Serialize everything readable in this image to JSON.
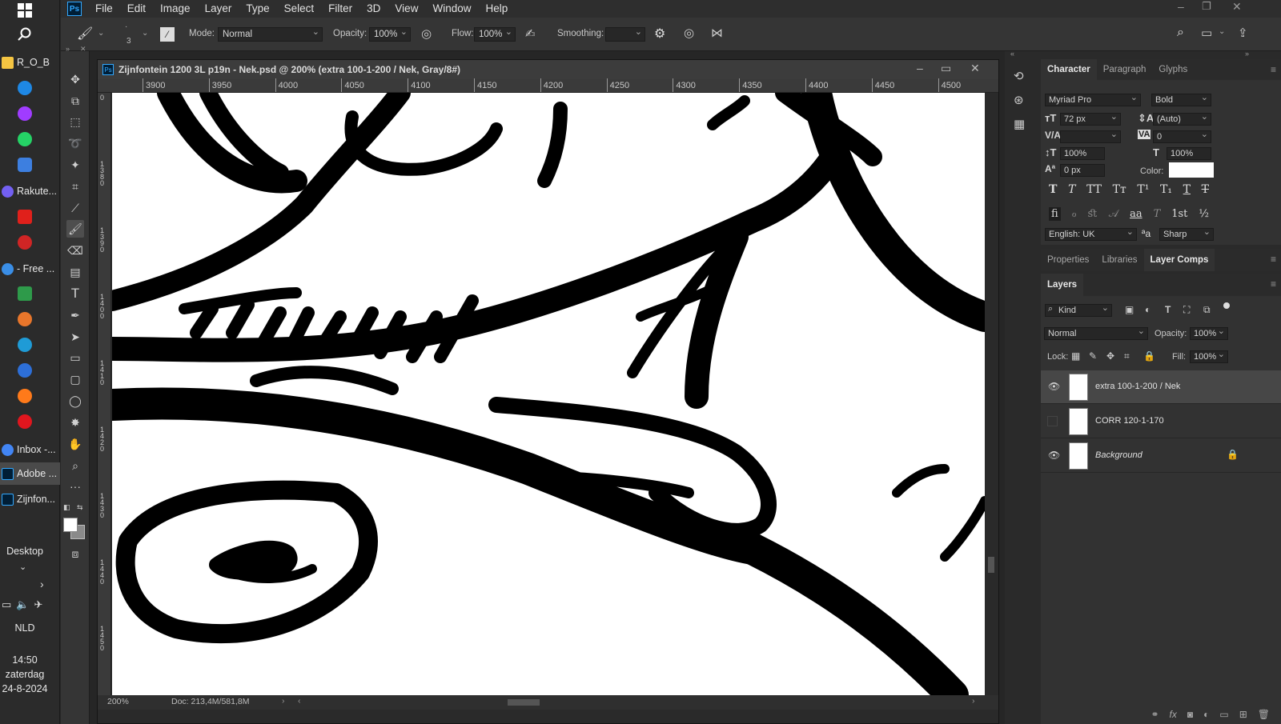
{
  "taskbar": {
    "items": [
      {
        "label": "R_O_B",
        "color": "#f5c542"
      },
      {
        "label": "Rakute...",
        "color": "#7360f2"
      },
      {
        "label": "- Free ...",
        "color": "#3a8ee6"
      },
      {
        "label": "Inbox -...",
        "color": "#4285f4"
      },
      {
        "label": "Adobe ...",
        "color": "#31a8ff"
      },
      {
        "label": "Zijnfon...",
        "color": "#31a8ff"
      }
    ],
    "desktop": "Desktop",
    "lang": "NLD",
    "time": "14:50",
    "day": "zaterdag",
    "date": "24-8-2024"
  },
  "menu": [
    "File",
    "Edit",
    "Image",
    "Layer",
    "Type",
    "Select",
    "Filter",
    "3D",
    "View",
    "Window",
    "Help"
  ],
  "logo": "Ps",
  "options": {
    "brush_size": "3",
    "mode_label": "Mode:",
    "mode_value": "Normal",
    "opacity_label": "Opacity:",
    "opacity_value": "100%",
    "flow_label": "Flow:",
    "flow_value": "100%",
    "smoothing_label": "Smoothing:",
    "smoothing_value": ""
  },
  "document": {
    "title": "Zijnfontein 1200 3L p19n - Nek.psd @ 200% (extra 100-1-200 / Nek, Gray/8#)",
    "ruler": [
      "3900",
      "3950",
      "4000",
      "4050",
      "4100",
      "4150",
      "4200",
      "4250",
      "4300",
      "4350",
      "4400",
      "4450",
      "4500"
    ],
    "vruler": [
      "0",
      "1380",
      "1390",
      "1400",
      "1410",
      "1420",
      "1430",
      "1440",
      "1450"
    ],
    "zoom": "200%",
    "doc_info": "Doc: 213,4M/581,8M"
  },
  "character": {
    "tabs": [
      "Character",
      "Paragraph",
      "Glyphs"
    ],
    "font_family": "Myriad Pro",
    "font_style": "Bold",
    "size": "72 px",
    "leading": "(Auto)",
    "kerning": "",
    "tracking": "0",
    "vscale": "100%",
    "hscale": "100%",
    "baseline": "0 px",
    "color_label": "Color:",
    "language": "English: UK",
    "aa_icon": "ªa",
    "antialias": "Sharp",
    "style_buttons": [
      "T",
      "T",
      "TT",
      "Tт",
      "T¹",
      "T₁",
      "T",
      "T"
    ],
    "otf_buttons": [
      "fi",
      "ℴ",
      "ﬆ",
      "𝒜",
      "aa",
      "T",
      "1st",
      "½"
    ]
  },
  "props_tabs": [
    "Properties",
    "Libraries",
    "Layer Comps"
  ],
  "layers": {
    "title": "Layers",
    "filter_kind": "Kind",
    "blend": "Normal",
    "opacity_label": "Opacity:",
    "opacity": "100%",
    "lock_label": "Lock:",
    "fill_label": "Fill:",
    "fill": "100%",
    "rows": [
      {
        "name": "extra 100-1-200 / Nek",
        "visible": true
      },
      {
        "name": "CORR 120-1-170",
        "visible": false
      },
      {
        "name": "Background",
        "visible": true
      }
    ]
  },
  "colors": {
    "accent": "#31a8ff",
    "canvas": "#ffffff",
    "ink": "#000000"
  }
}
